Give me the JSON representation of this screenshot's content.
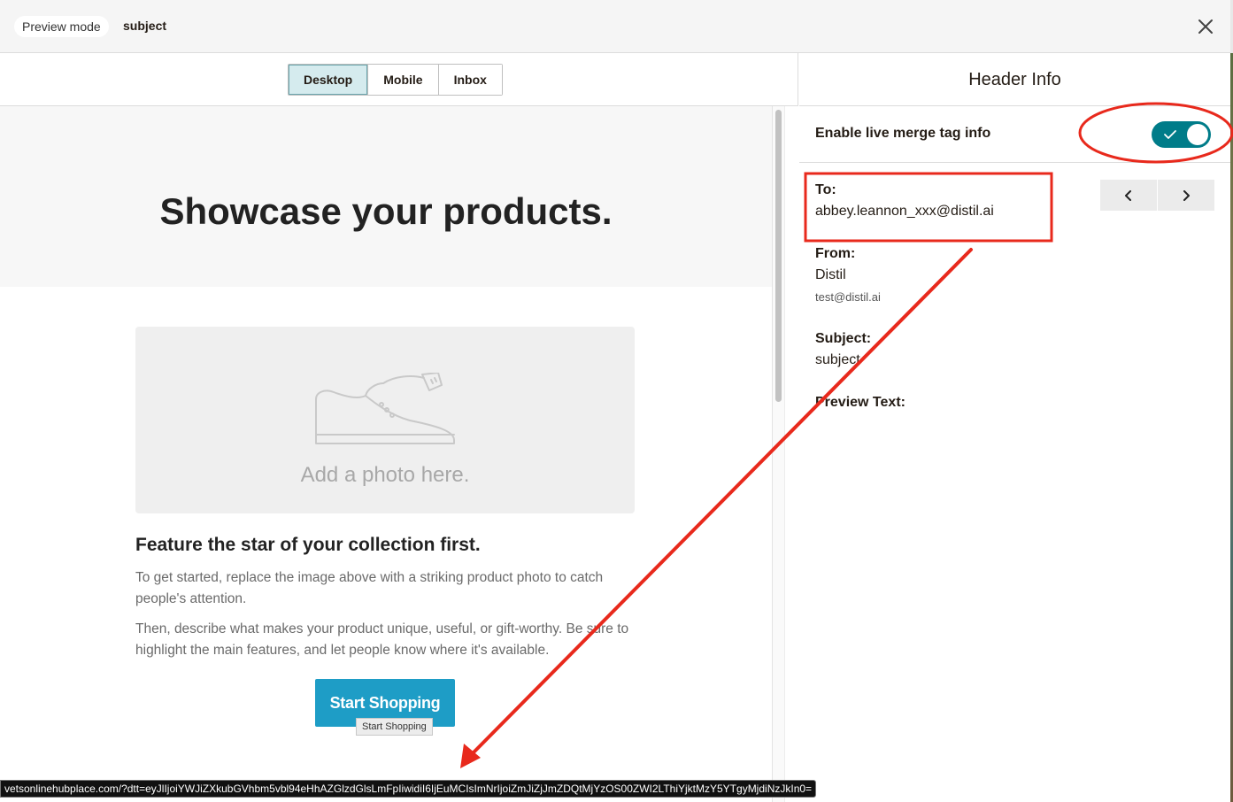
{
  "topbar": {
    "mode_label": "Preview mode",
    "subject": "subject",
    "close_icon": "close-icon"
  },
  "view_tabs": [
    {
      "label": "Desktop",
      "active": true
    },
    {
      "label": "Mobile",
      "active": false
    },
    {
      "label": "Inbox",
      "active": false
    }
  ],
  "email": {
    "hero_title": "Showcase your products.",
    "photo_placeholder": "Add a photo here.",
    "photo_icon": "shoe-icon",
    "feature_title": "Feature the star of your collection first.",
    "paragraph1": "To get started, replace the image above with a striking product photo to catch people's attention.",
    "paragraph2": "Then, describe what makes your product unique, useful, or gift-worthy. Be sure to highlight the main features, and let people know where it's available.",
    "cta_label": "Start Shopping",
    "cta_tooltip": "Start Shopping",
    "cta_color": "#1e9dc6"
  },
  "status_bar": {
    "url": "vetsonlinehubplace.com/?dtt=eyJlIjoiYWJiZXkubGVhbm5vbl94eHhAZGlzdGlsLmFpIiwidiI6IjEuMCIsImNrIjoiZmJiZjJmZDQtMjYzOS00ZWI2LThiYjktMzY5YTgyMjdiNzJkIn0="
  },
  "panel": {
    "title": "Header Info",
    "merge_toggle_label": "Enable live merge tag info",
    "merge_toggle_on": true,
    "toggle_color": "#007c89",
    "to_label": "To:",
    "to_value": "abbey.leannon_xxx@distil.ai",
    "from_label": "From:",
    "from_name": "Distil",
    "from_email": "test@distil.ai",
    "subject_label": "Subject:",
    "subject_value": "subject",
    "preview_text_label": "Preview Text:",
    "prev_icon": "chevron-left-icon",
    "next_icon": "chevron-right-icon"
  },
  "annotations": {
    "color": "#e8291c"
  }
}
